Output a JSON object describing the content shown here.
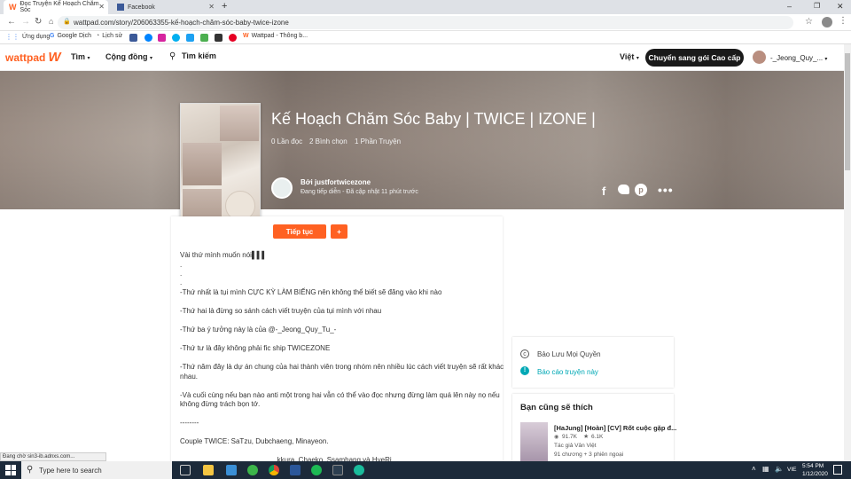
{
  "browser": {
    "tabs": [
      {
        "label": "Đọc Truyện Kế Hoạch Chăm Sóc"
      },
      {
        "label": "Facebook"
      }
    ],
    "new_tab": "+",
    "url": "wattpad.com/story/206063355-kế-hoạch-chăm-sóc-baby-twice-izone",
    "bookmarks": [
      {
        "label": "Ứng dụng"
      },
      {
        "label": "Google Dịch"
      },
      {
        "label": "Lịch sử"
      },
      {
        "label": "Wattpad - Thông b..."
      }
    ]
  },
  "header": {
    "logo": "wattpad",
    "nav_browse": "Tìm",
    "nav_community": "Cộng đồng",
    "search": "Tìm kiếm",
    "language": "Việt",
    "premium": "Chuyển sang gói Cao cấp",
    "username": "-_Jeong_Quy_..."
  },
  "story": {
    "title": "Kế Hoạch Chăm Sóc Baby | TWICE | IZONE |",
    "reads": "0 Lần đọc",
    "votes": "2 Bình chọn",
    "parts": "1 Phần Truyện",
    "author": "Bởi justfortwicezone",
    "status": "Đang tiếp diễn - Đã cập nhật 11 phút trước",
    "continue_btn": "Tiếp tục",
    "add_btn": "+"
  },
  "description": [
    "Vài thứ mình muốn nói▌▌▌",
    ".",
    ".",
    ".",
    "-Thứ nhất là tụi mình CỰC KỲ LÀM BIẾNG nên không thể biết sẽ đăng vào khi nào",
    "-Thứ hai là đừng so sánh cách viết truyện của tụi mình với nhau",
    "-Thứ ba ý tưởng này là của @-_Jeong_Quy_Tu_-",
    "-Thứ tư là đây không phải fic ship TWICEZONE",
    "-Thứ năm đây là dự án chung của hai thành viên trong nhóm nên nhiều lúc cách viết truyện sẽ rất khác",
    "nhau.",
    "-Và cuối cùng nếu bạn nào anti một trong hai vẫn có thể vào đọc nhưng đừng làm quá lên này nọ nếu",
    "không đừng trách bọn tớ.",
    "--------",
    "Couple TWICE: SaTzu, Dubchaeng, Minayeon.",
    "...kkura, Chaeko, Ssamhang và HyeRi"
  ],
  "sidebar": {
    "copyright": "Bảo Lưu Mọi Quyền",
    "report": "Báo cáo truyện này",
    "also_like_title": "Bạn cũng sẽ thích",
    "rec_title": "[HaJung] [Hoàn] [CV] Rốt cuộc gặp đ...",
    "rec_reads": "91.7K",
    "rec_votes": "6.1K",
    "rec_author": "Tác giả Vân Việt",
    "rec_parts": "91 chương + 3 phiên ngoại"
  },
  "statusbar": "Đang chờ sin3-ib.adnxs.com...",
  "taskbar": {
    "search": "Type here to search",
    "lang": "VIE",
    "time": "5:54 PM",
    "date": "1/12/2020"
  },
  "colors": {
    "accent": "#ff6122",
    "premium_bg": "#1a1a1a",
    "link": "#00a8b5"
  }
}
